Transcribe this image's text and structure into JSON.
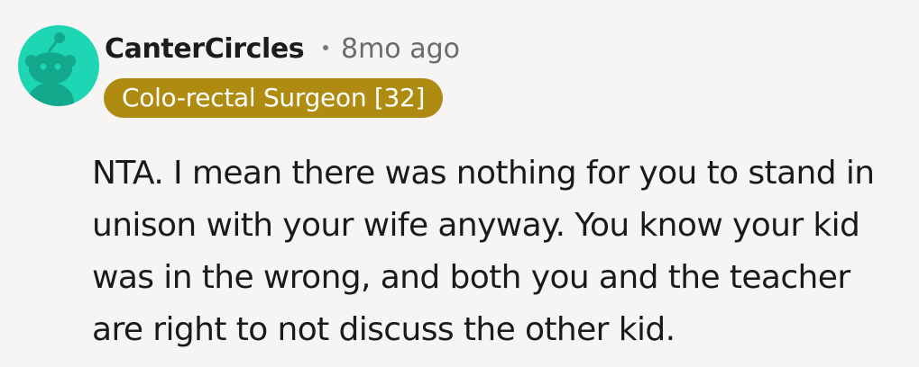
{
  "comment": {
    "avatar": {
      "icon": "reddit-snoo-avatar-icon",
      "background": "#1fd6b4"
    },
    "author": "CanterCircles",
    "separator": "•",
    "timestamp": "8mo ago",
    "flair": {
      "text": "Colo-rectal Surgeon [32]",
      "color": "#b08b12"
    },
    "body": "NTA. I mean there was nothing for you to stand in unison with your wife anyway. You know your kid was in the wrong, and both you and the teacher are right to not discuss the other kid."
  }
}
